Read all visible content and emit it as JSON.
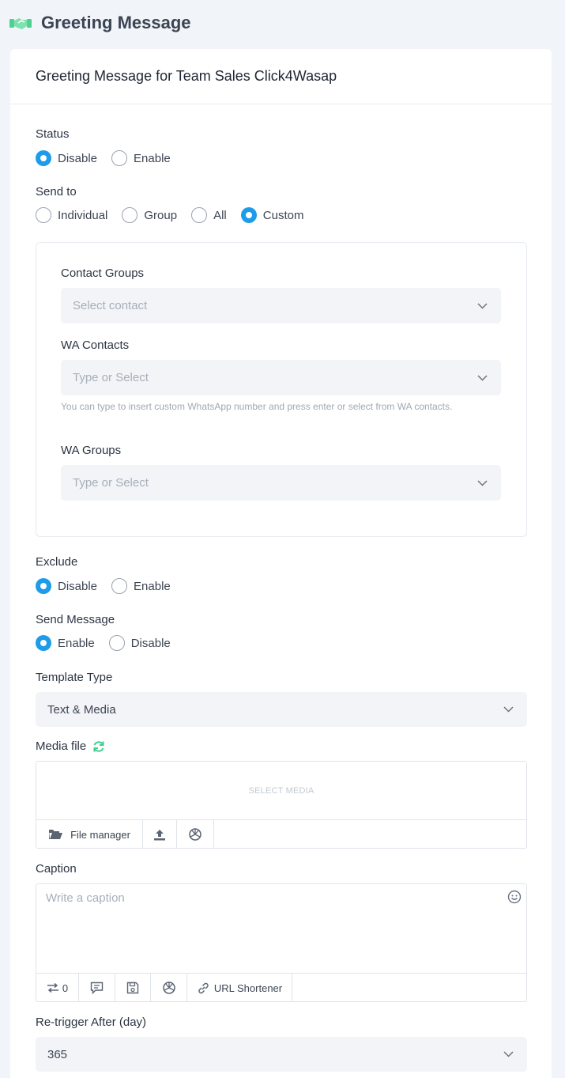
{
  "header": {
    "title": "Greeting Message"
  },
  "card": {
    "title": "Greeting Message for Team Sales Click4Wasap"
  },
  "status": {
    "label": "Status",
    "options": [
      "Disable",
      "Enable"
    ],
    "selected": "Disable"
  },
  "send_to": {
    "label": "Send to",
    "options": [
      "Individual",
      "Group",
      "All",
      "Custom"
    ],
    "selected": "Custom"
  },
  "custom": {
    "contact_groups": {
      "label": "Contact Groups",
      "placeholder": "Select contact"
    },
    "wa_contacts": {
      "label": "WA Contacts",
      "placeholder": "Type or Select",
      "help": "You can type to insert custom WhatsApp number and press enter or select from WA contacts."
    },
    "wa_groups": {
      "label": "WA Groups",
      "placeholder": "Type or Select"
    }
  },
  "exclude": {
    "label": "Exclude",
    "options": [
      "Disable",
      "Enable"
    ],
    "selected": "Disable"
  },
  "send_message": {
    "label": "Send Message",
    "options": [
      "Enable",
      "Disable"
    ],
    "selected": "Enable"
  },
  "template_type": {
    "label": "Template Type",
    "value": "Text & Media"
  },
  "media": {
    "label": "Media file",
    "select_text": "SELECT MEDIA",
    "file_manager_label": "File manager"
  },
  "caption": {
    "label": "Caption",
    "placeholder": "Write a caption",
    "spintax_count": "0",
    "url_shortener_label": "URL Shortener"
  },
  "retrigger": {
    "label": "Re-trigger After (day)",
    "value": "365"
  },
  "colors": {
    "accent": "#1e9be9",
    "brand_green": "#3ecf8e",
    "background": "#f1f4f8"
  }
}
